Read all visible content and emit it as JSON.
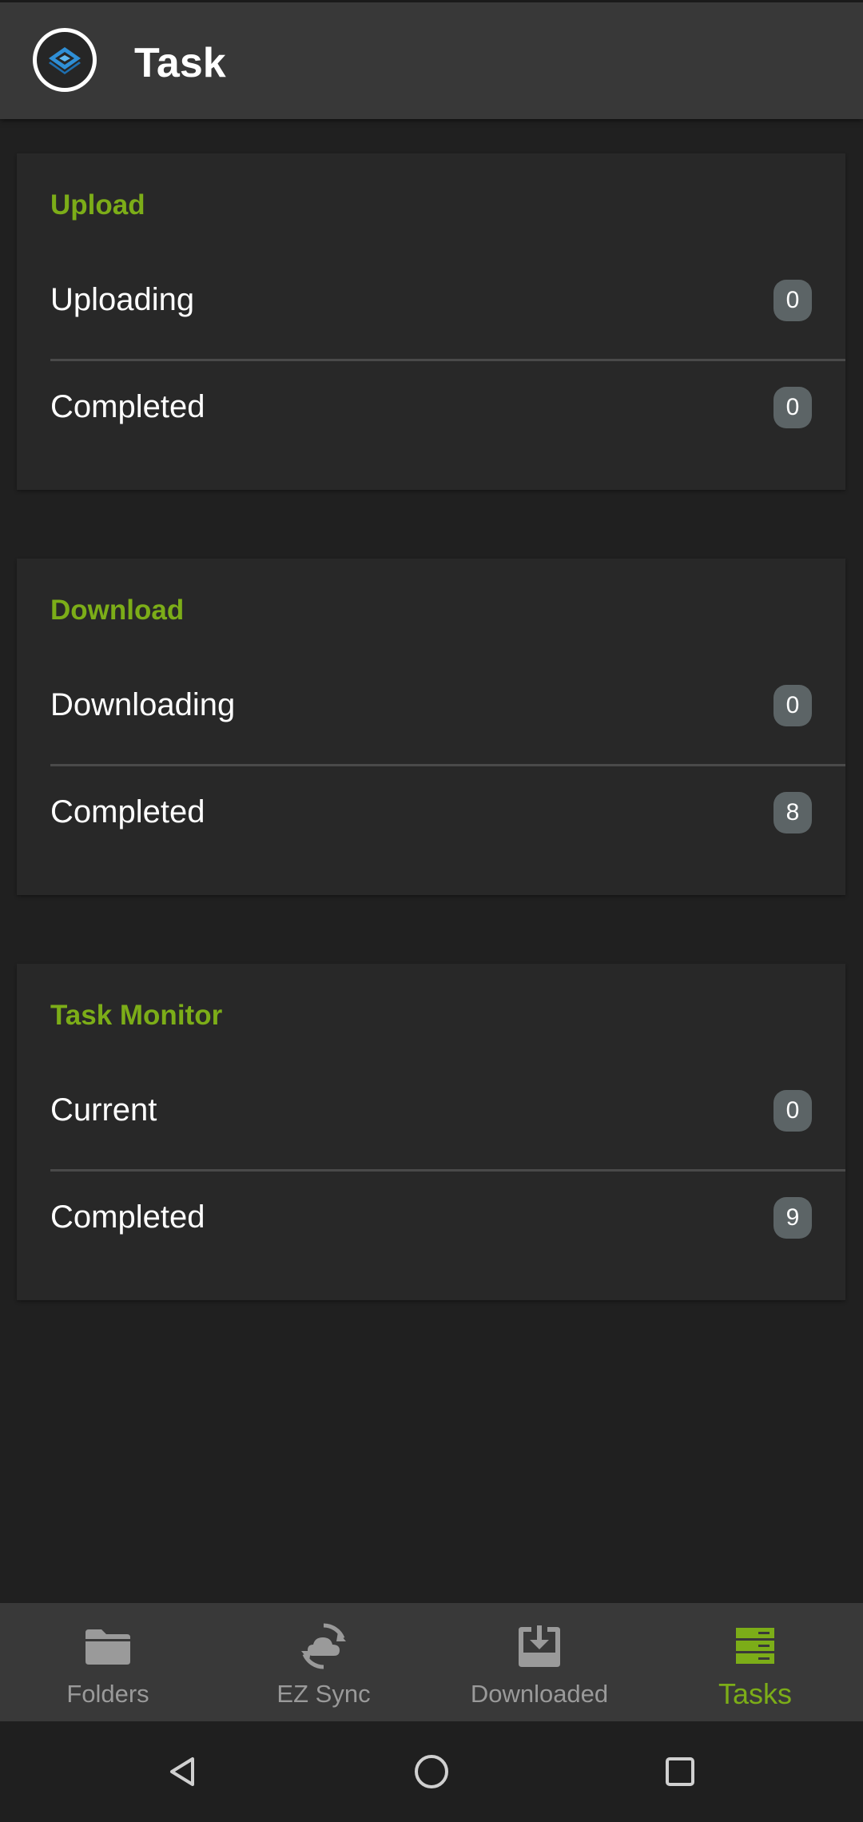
{
  "app_bar": {
    "title": "Task",
    "logo_icon": "app-logo-icon"
  },
  "sections": [
    {
      "header": "Upload",
      "rows": [
        {
          "label": "Uploading",
          "count": "0"
        },
        {
          "label": "Completed",
          "count": "0"
        }
      ]
    },
    {
      "header": "Download",
      "rows": [
        {
          "label": "Downloading",
          "count": "0"
        },
        {
          "label": "Completed",
          "count": "8"
        }
      ]
    },
    {
      "header": "Task Monitor",
      "rows": [
        {
          "label": "Current",
          "count": "0"
        },
        {
          "label": "Completed",
          "count": "9"
        }
      ]
    }
  ],
  "bottom_nav": {
    "items": [
      {
        "label": "Folders",
        "icon": "folder-icon",
        "active": false
      },
      {
        "label": "EZ Sync",
        "icon": "sync-cloud-icon",
        "active": false
      },
      {
        "label": "Downloaded",
        "icon": "download-tray-icon",
        "active": false
      },
      {
        "label": "Tasks",
        "icon": "tasks-stack-icon",
        "active": true
      }
    ]
  },
  "system_nav": {
    "back_icon": "back-triangle-icon",
    "home_icon": "home-circle-icon",
    "recents_icon": "recents-square-icon"
  },
  "colors": {
    "accent": "#7cad18",
    "background": "#202020",
    "card": "#282828",
    "app_bar": "#383838",
    "badge": "#5c6466",
    "inactive_nav": "#9a9a9a"
  }
}
